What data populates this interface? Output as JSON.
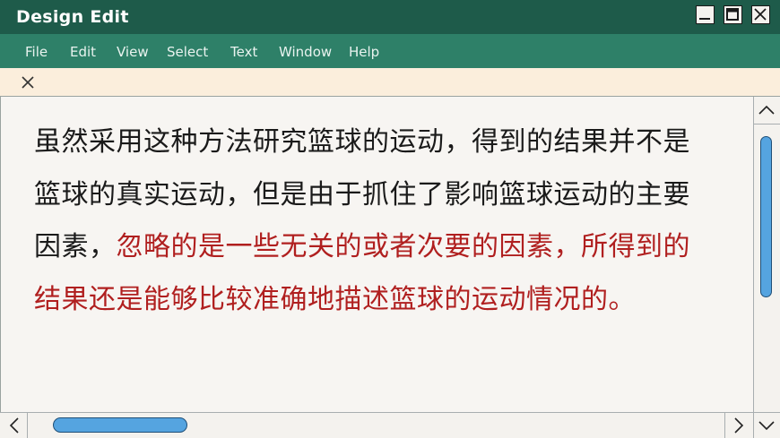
{
  "window": {
    "title": "Design Edit"
  },
  "menu": [
    "File",
    "Edit",
    "View",
    "Select",
    "Text",
    "Window",
    "Help"
  ],
  "content": {
    "line1": "虽然采用这种方法研究篮球的运动，得到的结果并不是",
    "line2": "篮球的真实运动，但是由于抓住了影响篮球运动的主要",
    "line3_black": "因素，",
    "line3_red": "忽略的是一些无关的或者次要的因素，所得到的",
    "line4_red": "结果还是能够比较准确地描述篮球的运动情况的。"
  },
  "colors": {
    "titlebar": "#1e5b4a",
    "menubar": "#2e8068",
    "notice": "#fbeedc",
    "highlight_text": "#b01f1f",
    "scroll_thumb": "#55a4e0"
  },
  "icons": [
    "minimize-icon",
    "maximize-icon",
    "close-icon",
    "notice-close-icon",
    "scroll-up-icon",
    "scroll-down-icon",
    "scroll-left-icon",
    "scroll-right-icon"
  ]
}
